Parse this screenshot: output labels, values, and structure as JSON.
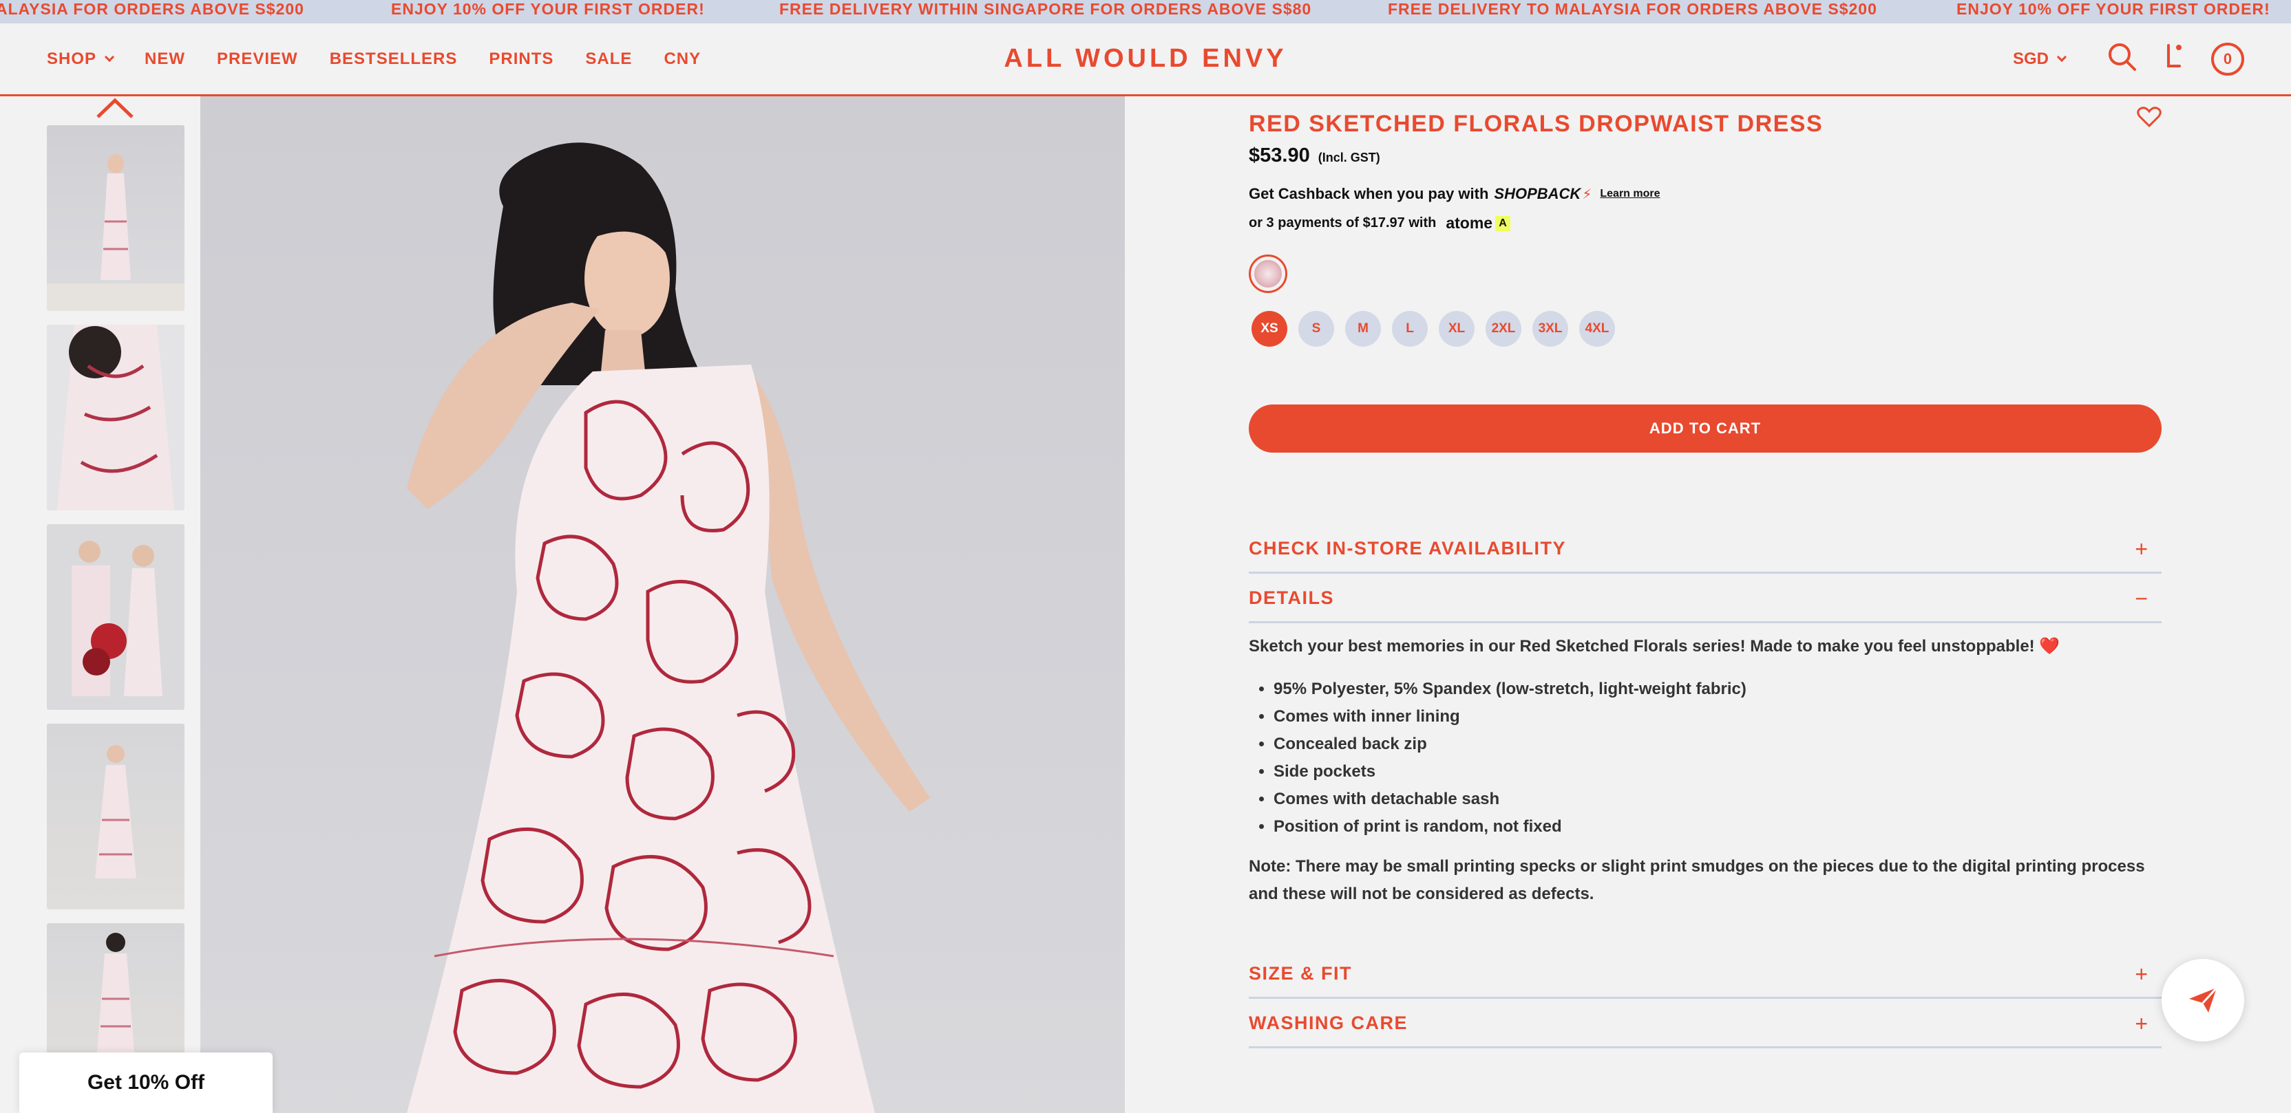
{
  "announcements": [
    "ALAYSIA FOR ORDERS ABOVE S$200",
    "ENJOY 10% OFF YOUR FIRST ORDER!",
    "FREE DELIVERY WITHIN SINGAPORE FOR ORDERS ABOVE S$80",
    "FREE DELIVERY TO MALAYSIA FOR ORDERS ABOVE S$200",
    "ENJOY 10% OFF YOUR FIRST ORDER!"
  ],
  "header": {
    "logo": "ALL WOULD ENVY",
    "nav": [
      "SHOP",
      "NEW",
      "PREVIEW",
      "BESTSELLERS",
      "PRINTS",
      "SALE",
      "CNY"
    ],
    "currency": "SGD",
    "cart_count": "0"
  },
  "product": {
    "title": "RED SKETCHED FLORALS DROPWAIST DRESS",
    "price": "$53.90",
    "price_note": "(Incl. GST)",
    "cashback_text": "Get Cashback when you pay with",
    "cashback_brand": "SHOPBACK",
    "learn_more": "Learn more",
    "installments_text": "or 3 payments of $17.97 with",
    "installments_brand": "atome",
    "sizes": [
      "XS",
      "S",
      "M",
      "L",
      "XL",
      "2XL",
      "3XL",
      "4XL"
    ],
    "selected_size": "XS",
    "add_to_cart": "ADD TO CART"
  },
  "accordions": {
    "instore": "CHECK IN-STORE AVAILABILITY",
    "details": "DETAILS",
    "size_fit": "SIZE & FIT",
    "washing": "WASHING CARE"
  },
  "details": {
    "intro": "Sketch your best memories in our Red Sketched Florals series! Made to make you feel unstoppable! ❤️",
    "bullets": [
      "95% Polyester, 5% Spandex (low-stretch, light-weight fabric)",
      "Comes with inner lining",
      "Concealed back zip",
      "Side pockets",
      "Comes with detachable sash",
      "Position of print is random, not fixed"
    ],
    "note": "Note: There may be small printing specks or slight print smudges on the pieces due to the digital printing process and these will not be considered as defects."
  },
  "promo": "Get 10% Off",
  "colors": {
    "accent": "#e84a2f",
    "pill": "#d3d9e6",
    "bar": "#cfd6e6"
  }
}
